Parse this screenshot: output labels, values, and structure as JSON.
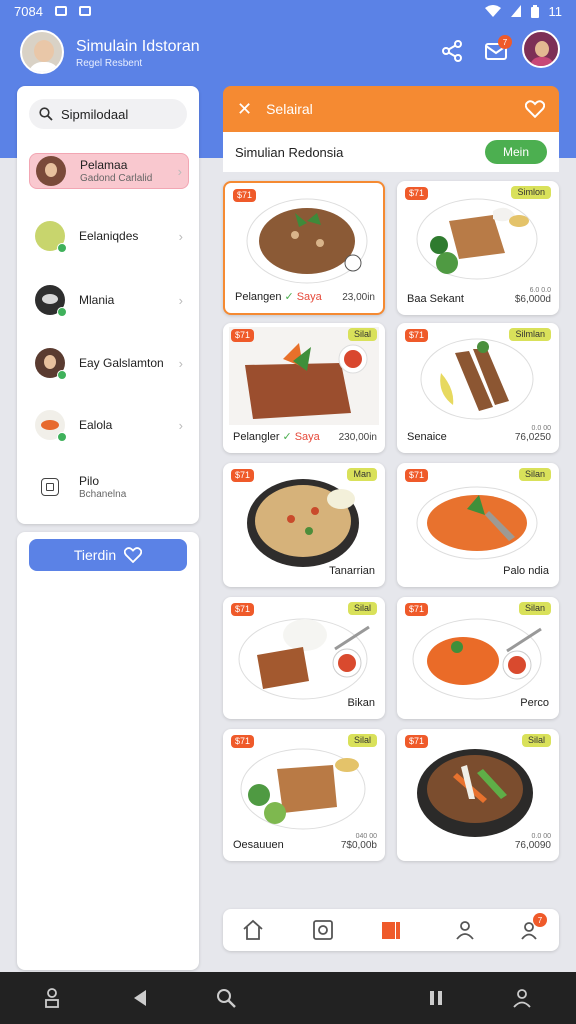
{
  "status_bar": {
    "time": "7084",
    "right_text": "11"
  },
  "app_bar": {
    "title": "Simulain Idstoran",
    "subtitle": "Regel Resbent",
    "message_badge": "7"
  },
  "sidebar": {
    "search_placeholder": "Sipmilodaal",
    "contacts": [
      {
        "name": "Pelamaa",
        "sub": "Gadond Carlalid"
      },
      {
        "name": "Eelaniqdes",
        "sub": ""
      },
      {
        "name": "Mlania",
        "sub": ""
      },
      {
        "name": "Eay Galslamton",
        "sub": ""
      },
      {
        "name": "Ealola",
        "sub": ""
      },
      {
        "name": "Pilo",
        "sub": "Bchanelna"
      }
    ],
    "action_button": "Tierdin"
  },
  "panel": {
    "header_title": "Selairal",
    "sub_title": "Simulian Redonsia",
    "menu_button": "Mein"
  },
  "dishes": [
    {
      "num": "$71",
      "kind": "",
      "name": "Pelangen",
      "suffix": "Saya",
      "price": "23,00in",
      "price_small": ""
    },
    {
      "num": "$71",
      "kind": "Simlon",
      "name": "Baa Sekant",
      "suffix": "",
      "price": "$6,000d",
      "price_small": "6.0 0.0"
    },
    {
      "num": "$71",
      "kind": "Silal",
      "name": "Pelangler",
      "suffix": "Saya",
      "price": "230,00in",
      "price_small": ""
    },
    {
      "num": "$71",
      "kind": "Silmlan",
      "name": "Senaice",
      "suffix": "",
      "price": "76,0250",
      "price_small": "0.0 00"
    },
    {
      "num": "$71",
      "kind": "Man",
      "name": "Tanarrian",
      "suffix": "",
      "price": "",
      "price_small": ""
    },
    {
      "num": "$71",
      "kind": "Silan",
      "name": "Palo ndia",
      "suffix": "",
      "price": "",
      "price_small": ""
    },
    {
      "num": "$71",
      "kind": "Silal",
      "name": "Bikan",
      "suffix": "",
      "price": "",
      "price_small": ""
    },
    {
      "num": "$71",
      "kind": "Silan",
      "name": "Perco",
      "suffix": "",
      "price": "",
      "price_small": ""
    },
    {
      "num": "$71",
      "kind": "Silal",
      "name": "Oesauuen",
      "suffix": "",
      "price": "7$0,00b",
      "price_small": "040 00"
    },
    {
      "num": "$71",
      "kind": "Silal",
      "name": "",
      "suffix": "",
      "price": "76,0090",
      "price_small": "0.0 00"
    }
  ],
  "bottom_nav": {
    "badge": "7"
  },
  "colors": {
    "primary": "#5b82e6",
    "accent": "#f58a32",
    "green": "#4caf50",
    "tag_red": "#ef5a2a",
    "tag_yellow": "#d9e15a"
  }
}
